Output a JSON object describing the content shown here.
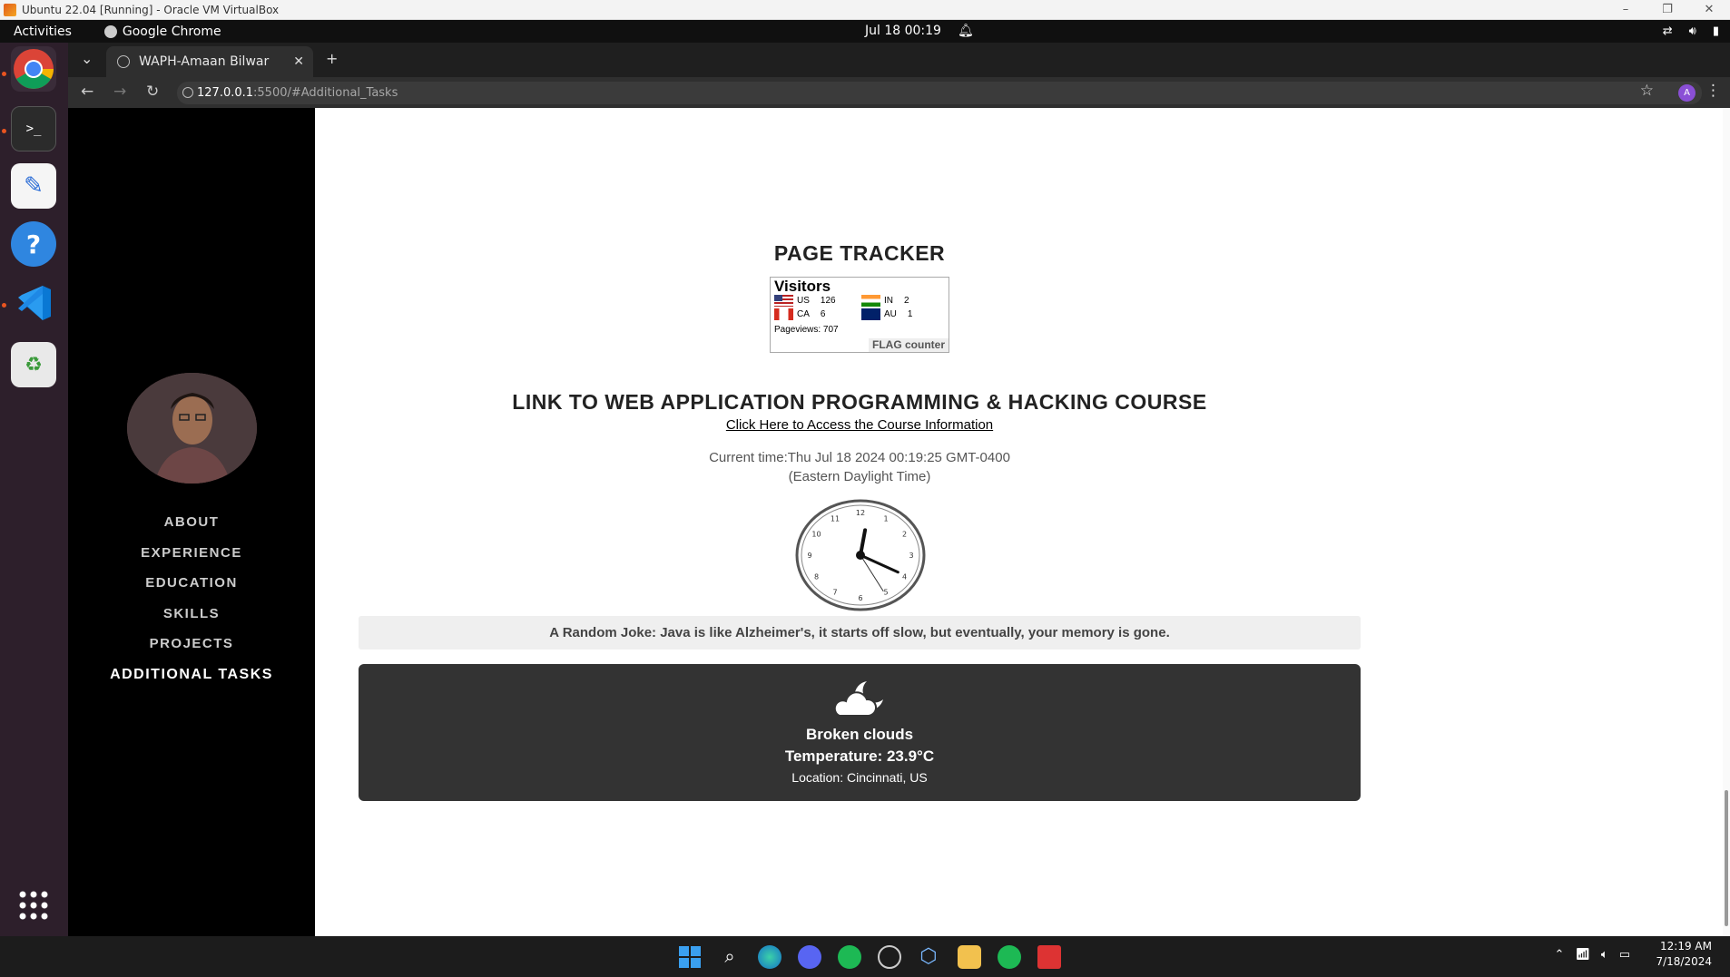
{
  "vbox": {
    "title": "Ubuntu 22.04 [Running] - Oracle VM VirtualBox",
    "controls": [
      "–",
      "❐",
      "✕"
    ]
  },
  "gnome": {
    "activities": "Activities",
    "app_name": "Google Chrome",
    "clock": "Jul 18  00:19"
  },
  "browser": {
    "tab_title": "WAPH-Amaan Bilwar",
    "url_host": "127.0.0.1",
    "url_path": ":5500/#Additional_Tasks",
    "profile_initial": "A"
  },
  "sidebar": {
    "nav": [
      {
        "label": "ABOUT"
      },
      {
        "label": "EXPERIENCE"
      },
      {
        "label": "EDUCATION"
      },
      {
        "label": "SKILLS"
      },
      {
        "label": "PROJECTS"
      },
      {
        "label": "ADDITIONAL TASKS",
        "active": true
      }
    ]
  },
  "main": {
    "page_tracker_title": "PAGE TRACKER",
    "flag_counter": {
      "heading": "Visitors",
      "rows": [
        {
          "code": "US",
          "count": "126"
        },
        {
          "code": "IN",
          "count": "2"
        },
        {
          "code": "CA",
          "count": "6"
        },
        {
          "code": "AU",
          "count": "1"
        }
      ],
      "pageviews_label": "Pageviews:",
      "pageviews_value": "707",
      "brand": "FLAG counter"
    },
    "course_title": "LINK TO WEB APPLICATION PROGRAMMING & HACKING COURSE",
    "course_link": "Click Here to Access the Course Information",
    "current_time": "Current time:Thu Jul 18 2024 00:19:25 GMT-0400 (Eastern Daylight Time)",
    "clock_time": {
      "hours": 0,
      "minutes": 19,
      "seconds": 25
    },
    "joke": "A Random Joke: Java is like Alzheimer's, it starts off slow, but eventually, your memory is gone.",
    "weather": {
      "condition": "Broken clouds",
      "temperature": "Temperature: 23.9°C",
      "location": "Location: Cincinnati, US"
    }
  },
  "taskbar": {
    "time": "12:19 AM",
    "date": "7/18/2024"
  }
}
